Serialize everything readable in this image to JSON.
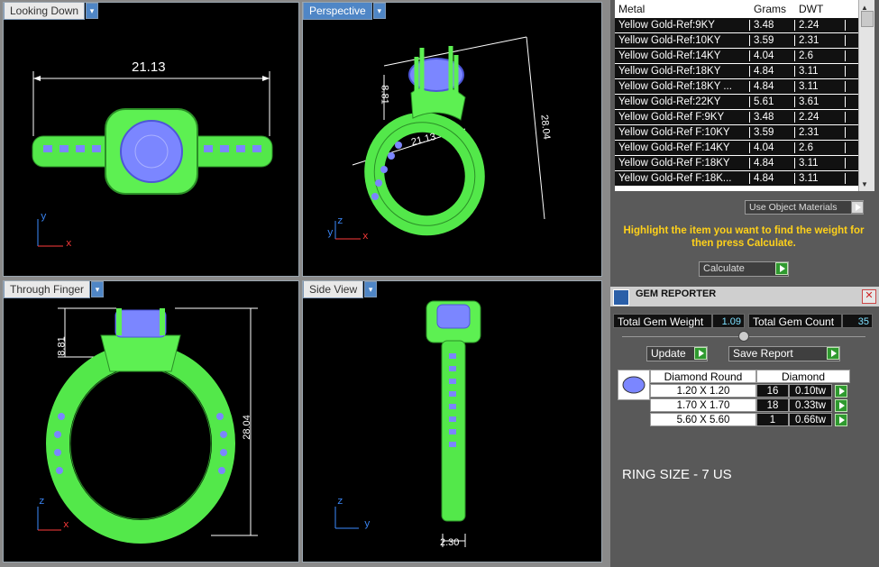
{
  "viewports": {
    "looking_down": {
      "label": "Looking Down",
      "dimension": "21.13",
      "axis_y": "y",
      "axis_x": "x"
    },
    "perspective": {
      "label": "Perspective",
      "dim_height": "8.81",
      "dim_width": "21.13",
      "dim_total": "28.04",
      "axis_z": "z",
      "axis_y": "y",
      "axis_x": "x"
    },
    "through_finger": {
      "label": "Through Finger",
      "dim_height": "8.81",
      "dim_total": "28.04",
      "axis_z": "z",
      "axis_x": "x"
    },
    "side_view": {
      "label": "Side View",
      "dim_width": "2.30",
      "axis_z": "z",
      "axis_y": "y"
    }
  },
  "metal_table": {
    "headers": [
      "Metal",
      "Grams",
      "DWT"
    ],
    "rows": [
      [
        "Yellow Gold-Ref:9KY",
        "3.48",
        "2.24"
      ],
      [
        "Yellow Gold-Ref:10KY",
        "3.59",
        "2.31"
      ],
      [
        "Yellow Gold-Ref:14KY",
        "4.04",
        "2.6"
      ],
      [
        "Yellow Gold-Ref:18KY",
        "4.84",
        "3.11"
      ],
      [
        "Yellow Gold-Ref:18KY ...",
        "4.84",
        "3.11"
      ],
      [
        "Yellow Gold-Ref:22KY",
        "5.61",
        "3.61"
      ],
      [
        "Yellow Gold-Ref F:9KY",
        "3.48",
        "2.24"
      ],
      [
        "Yellow Gold-Ref F:10KY",
        "3.59",
        "2.31"
      ],
      [
        "Yellow Gold-Ref F:14KY",
        "4.04",
        "2.6"
      ],
      [
        "Yellow Gold-Ref F:18KY",
        "4.84",
        "3.11"
      ],
      [
        "Yellow Gold-Ref F:18K...",
        "4.84",
        "3.11"
      ]
    ]
  },
  "use_object_materials": "Use Object Materials",
  "hint": "Highlight the item you want to find the weight for then press Calculate.",
  "calculate_label": "Calculate",
  "gem_reporter": {
    "title": "GEM REPORTER",
    "total_weight_label": "Total Gem Weight",
    "total_weight": "1.09",
    "total_count_label": "Total Gem Count",
    "total_count": "35",
    "update_label": "Update",
    "save_label": "Save Report",
    "col1": "Diamond Round",
    "col2": "Diamond",
    "rows": [
      [
        "1.20 X 1.20",
        "16",
        "0.10tw"
      ],
      [
        "1.70 X 1.70",
        "18",
        "0.33tw"
      ],
      [
        "5.60 X 5.60",
        "1",
        "0.66tw"
      ]
    ]
  },
  "ring_size": "RING SIZE - 7 US",
  "colors": {
    "ring": "#66ff55",
    "gem": "#7b86ff",
    "accent": "#4f86c6",
    "hint": "#ffd11a"
  }
}
